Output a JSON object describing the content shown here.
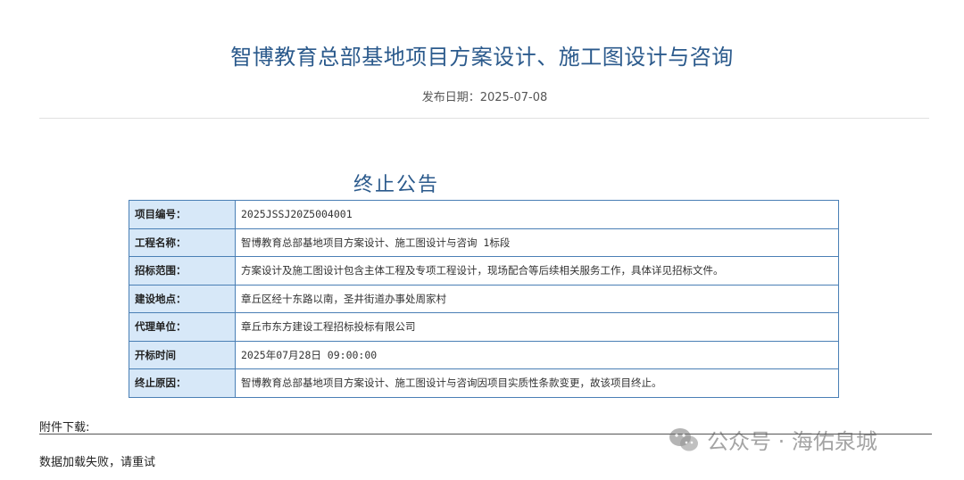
{
  "header": {
    "title": "智博教育总部基地项目方案设计、施工图设计与咨询",
    "publish_date": "发布日期：2025-07-08"
  },
  "notice": {
    "heading": "终止公告",
    "rows": [
      {
        "label": "项目编号：",
        "value": "2025JSSJ20Z5004001"
      },
      {
        "label": "工程名称：",
        "value": "智博教育总部基地项目方案设计、施工图设计与咨询 1标段"
      },
      {
        "label": "招标范围：",
        "value": "方案设计及施工图设计包含主体工程及专项工程设计，现场配合等后续相关服务工作，具体详见招标文件。"
      },
      {
        "label": "建设地点：",
        "value": "章丘区经十东路以南，圣井街道办事处周家村"
      },
      {
        "label": "代理单位：",
        "value": "章丘市东方建设工程招标投标有限公司"
      },
      {
        "label": "开标时间",
        "value": "2025年07月28日 09:00:00"
      },
      {
        "label": "终止原因：",
        "value": "智博教育总部基地项目方案设计、施工图设计与咨询因项目实质性条款变更，故该项目终止。"
      }
    ]
  },
  "attachments": {
    "label": "附件下载:",
    "status": "数据加载失败，请重试"
  },
  "watermark": {
    "icon": "wechat-icon",
    "text": "公众号 · 海佑泉城"
  }
}
